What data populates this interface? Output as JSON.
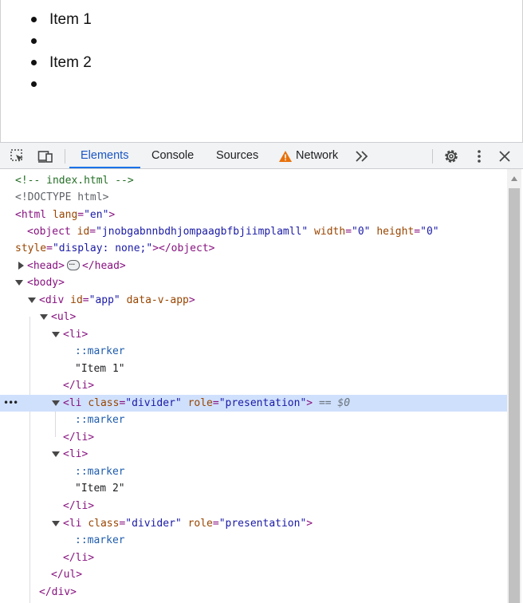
{
  "page": {
    "list_items": [
      {
        "text": "Item 1"
      },
      {
        "text": ""
      },
      {
        "text": "Item 2"
      },
      {
        "text": ""
      }
    ]
  },
  "devtools": {
    "tabs": [
      {
        "label": "Elements",
        "active": true
      },
      {
        "label": "Console",
        "active": false
      },
      {
        "label": "Sources",
        "active": false
      },
      {
        "label": "Network",
        "active": false,
        "warning": true
      }
    ],
    "toolbar_icons": [
      "inspect-element-icon",
      "device-toolbar-icon",
      "more-tabs-icon",
      "settings-gear-icon",
      "kebab-menu-icon",
      "close-icon"
    ],
    "dom": {
      "comment": "<!-- index.html -->",
      "doctype": "<!DOCTYPE html>",
      "html_open": "<html",
      "html_lang_attr": "lang",
      "html_lang_val": "\"en\"",
      "object_tag": "<object",
      "object_id_attr": "id",
      "object_id_val": "\"jnobgabnnbdhjompaagbfbjiimplamll\"",
      "object_width_attr": "width",
      "object_width_val": "\"0\"",
      "object_height_attr": "height",
      "object_height_val": "\"0\"",
      "object_style_attr": "style",
      "object_style_val": "\"display: none;\"",
      "object_close": "></object>",
      "head_open": "<head>",
      "head_close": "</head>",
      "body_open": "<body>",
      "div_open": "<div",
      "div_id_attr": "id",
      "div_id_val": "\"app\"",
      "div_data_attr": "data-v-app",
      "ul_open": "<ul>",
      "li_open": "<li>",
      "li_tag_start": "<li",
      "li_class_attr": "class",
      "li_class_val": "\"divider\"",
      "li_role_attr": "role",
      "li_role_val": "\"presentation\"",
      "marker": "::marker",
      "item1_text": "\"Item 1\"",
      "item2_text": "\"Item 2\"",
      "li_close": "</li>",
      "ul_close": "</ul>",
      "div_close": "</div>",
      "selected_suffix": "== $0"
    },
    "selected_node": "li.divider"
  },
  "colors": {
    "tag": "#881280",
    "attr_name": "#994500",
    "attr_value": "#1a1aa6",
    "selected_row": "#cfe0fc",
    "active_tab": "#1a73e8",
    "warning": "#e8710a"
  }
}
